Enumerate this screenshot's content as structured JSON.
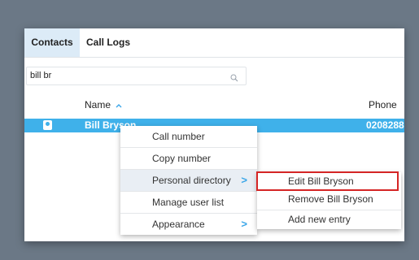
{
  "tabs": [
    {
      "label": "Contacts",
      "active": true
    },
    {
      "label": "Call Logs",
      "active": false
    }
  ],
  "search": {
    "value": "bill br",
    "icon": "search-icon"
  },
  "table": {
    "columns": {
      "name": "Name",
      "sort_indicator": "^",
      "phone": "Phone"
    },
    "selected_row": {
      "name": "Bill Bryson",
      "phone": "0208288"
    }
  },
  "context_menu": {
    "items": [
      {
        "label": "Call number"
      },
      {
        "label": "Copy number"
      },
      {
        "label": "Personal directory",
        "submenu": true
      },
      {
        "label": "Manage user list"
      },
      {
        "label": "Appearance",
        "submenu": true
      }
    ],
    "arrow": ">"
  },
  "submenu": {
    "items": [
      {
        "label": "Edit Bill Bryson",
        "highlighted": true
      },
      {
        "label": "Remove Bill Bryson"
      },
      {
        "label": "Add new entry"
      }
    ]
  },
  "colors": {
    "accent": "#3fb1ea",
    "highlight_border": "#d52525",
    "tab_active_bg": "#dcebf7"
  }
}
